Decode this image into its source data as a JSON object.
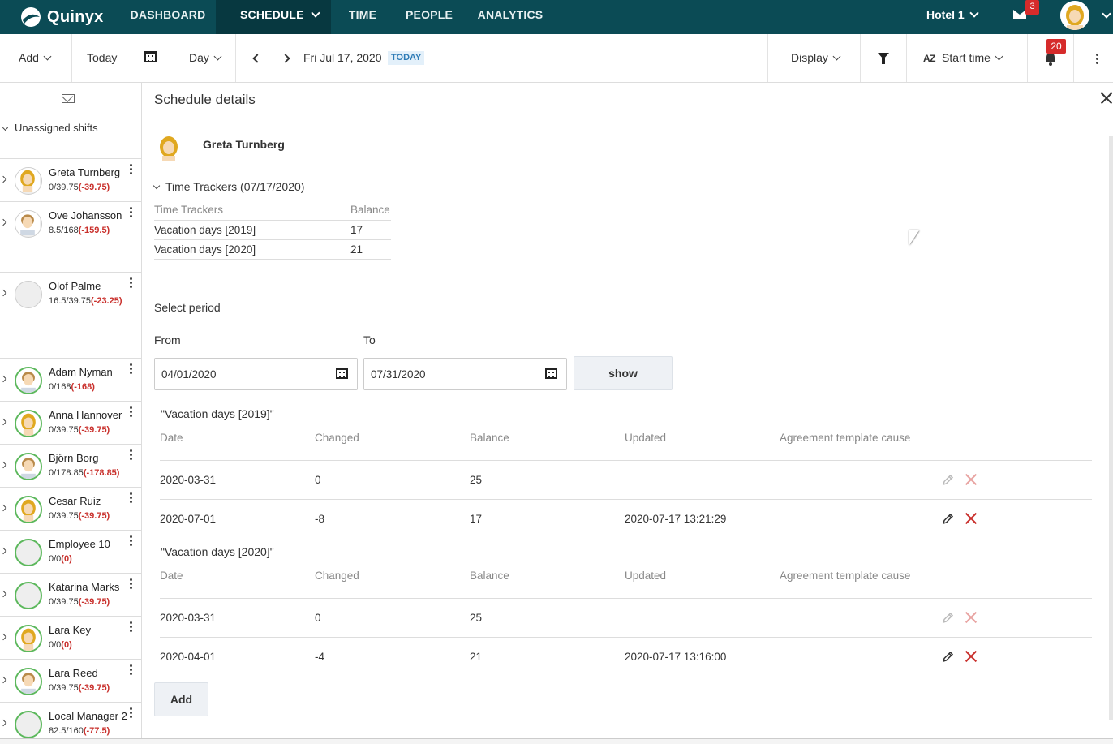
{
  "app": {
    "logo_text": "Quinyx",
    "nav": [
      {
        "label": "DASHBOARD"
      },
      {
        "label": "SCHEDULE"
      },
      {
        "label": "TIME"
      },
      {
        "label": "PEOPLE"
      },
      {
        "label": "ANALYTICS"
      }
    ],
    "active_nav": "SCHEDULE",
    "unit": "Hotel 1",
    "mail_count": "3",
    "accent_color": "#0b4b55"
  },
  "toolbar": {
    "add_label": "Add",
    "today_label": "Today",
    "view_label": "Day",
    "date": "Fri Jul 17, 2020",
    "today_badge": "TODAY",
    "display_label": "Display",
    "sort_icon_text": "AZ",
    "sort_label": "Start time",
    "notification_count": "20"
  },
  "sidebar": {
    "unassigned_label": "Unassigned shifts",
    "employees": [
      {
        "name": "Greta Turnberg",
        "hours": "0/39.75",
        "delta": "(-39.75)",
        "avatar": "female"
      },
      {
        "name": "Ove Johansson",
        "hours": "8.5/168",
        "delta": "(-159.5)",
        "avatar": "male"
      },
      {
        "name": "Olof Palme",
        "hours": "16.5/39.75",
        "delta": "(-23.25)",
        "avatar": "none"
      },
      {
        "name": "Adam Nyman",
        "hours": "0/168",
        "delta": "(-168)",
        "avatar": "male"
      },
      {
        "name": "Anna Hannover",
        "hours": "0/39.75",
        "delta": "(-39.75)",
        "avatar": "female"
      },
      {
        "name": "Björn Borg",
        "hours": "0/178.85",
        "delta": "(-178.85)",
        "avatar": "male"
      },
      {
        "name": "Cesar Ruiz",
        "hours": "0/39.75",
        "delta": "(-39.75)",
        "avatar": "female"
      },
      {
        "name": "Employee 10",
        "hours": "0/0",
        "delta": "(0)",
        "avatar": "none"
      },
      {
        "name": "Katarina Marks",
        "hours": "0/39.75",
        "delta": "(-39.75)",
        "avatar": "none"
      },
      {
        "name": "Lara Key",
        "hours": "0/0",
        "delta": "(0)",
        "avatar": "female"
      },
      {
        "name": "Lara Reed",
        "hours": "0/39.75",
        "delta": "(-39.75)",
        "avatar": "male"
      },
      {
        "name": "Local Manager 2",
        "hours": "82.5/160",
        "delta": "(-77.5)",
        "avatar": "none"
      }
    ]
  },
  "panel": {
    "title": "Schedule details",
    "employee_name": "Greta Turnberg",
    "time_trackers_header": "Time Trackers (07/17/2020)",
    "tt_columns": [
      "Time Trackers",
      "Balance"
    ],
    "tt_rows": [
      {
        "name": "Vacation days [2019]",
        "balance": "17"
      },
      {
        "name": "Vacation days [2020]",
        "balance": "21"
      }
    ],
    "select_period": "Select period",
    "from_label": "From",
    "to_label": "To",
    "from_value": "04/01/2020",
    "to_value": "07/31/2020",
    "show_label": "show",
    "columns": [
      "Date",
      "Changed",
      "Balance",
      "Updated",
      "Agreement template cause"
    ],
    "sections": [
      {
        "title": "\"Vacation days [2019]\"",
        "rows": [
          {
            "date": "2020-03-31",
            "changed": "0",
            "balance": "25",
            "updated": "",
            "cause": "",
            "editable": false
          },
          {
            "date": "2020-07-01",
            "changed": "-8",
            "balance": "17",
            "updated": "2020-07-17 13:21:29",
            "cause": "",
            "editable": true
          }
        ]
      },
      {
        "title": "\"Vacation days [2020]\"",
        "rows": [
          {
            "date": "2020-03-31",
            "changed": "0",
            "balance": "25",
            "updated": "",
            "cause": "",
            "editable": false
          },
          {
            "date": "2020-04-01",
            "changed": "-4",
            "balance": "21",
            "updated": "2020-07-17 13:16:00",
            "cause": "",
            "editable": true
          }
        ]
      }
    ],
    "add_label": "Add"
  }
}
